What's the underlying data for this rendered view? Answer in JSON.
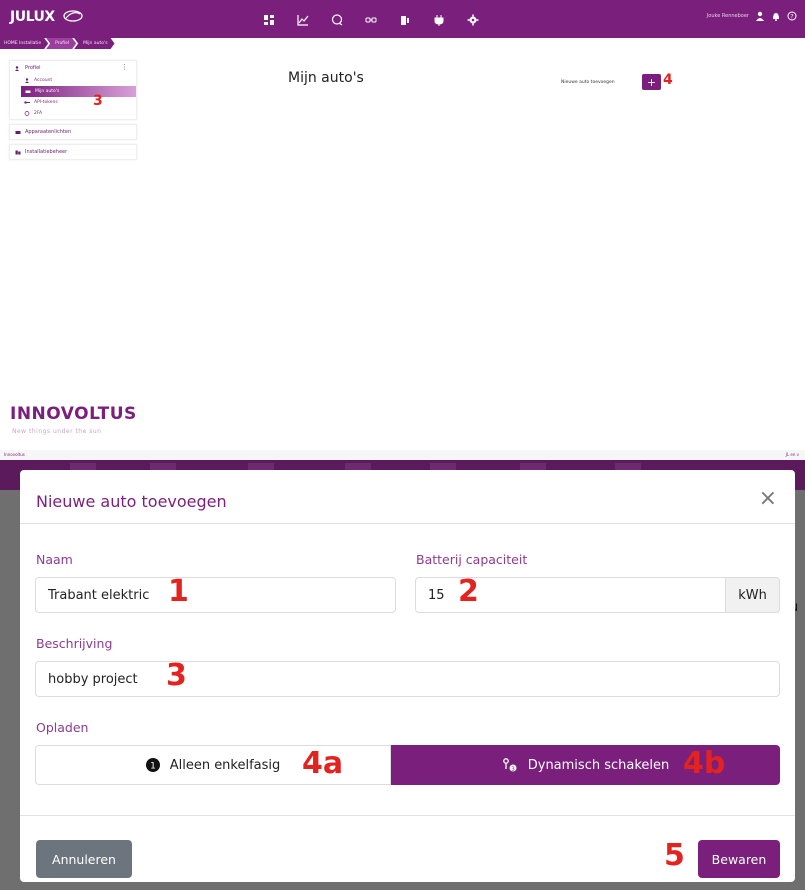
{
  "app": {
    "logo": "JULUX"
  },
  "topbar": {
    "username": "Jouke Renneboer"
  },
  "breadcrumbs": [
    "HOME Installatie",
    "Profiel",
    "Mijn auto's"
  ],
  "sidebar": {
    "groups": [
      {
        "label": "Profiel",
        "items": [
          {
            "label": "Account"
          },
          {
            "label": "Mijn auto's",
            "active": true
          },
          {
            "label": "API-tokens"
          },
          {
            "label": "2FA"
          }
        ]
      },
      {
        "label": "Apparaatenlichten",
        "items": []
      },
      {
        "label": "Installatiebeheer",
        "items": []
      }
    ]
  },
  "main": {
    "title": "Mijn auto's",
    "add_label": "Nieuwe auto toevoegen",
    "add_button": "+"
  },
  "annotations": {
    "a1": "1",
    "a2": "2",
    "a3": "3",
    "a3_sidebar": "3",
    "a4": "4",
    "a4a": "4a",
    "a4b": "4b",
    "a5": "5"
  },
  "brand": {
    "name": "INNOVOLTUS",
    "tagline": "New things under the sun"
  },
  "footer": {
    "left": "Innovoltus",
    "right": "JL en v"
  },
  "modal": {
    "title": "Nieuwe auto toevoegen",
    "close": "×",
    "name_label": "Naam",
    "name_value": "Trabant elektric",
    "battery_label": "Batterij capaciteit",
    "battery_value": "15",
    "battery_unit": "kWh",
    "description_label": "Beschrijving",
    "description_value": "hobby project",
    "charging_label": "Opladen",
    "option_single": "Alleen enkelfasig",
    "option_dynamic": "Dynamisch schakelen",
    "cancel": "Annuleren",
    "save": "Bewaren"
  },
  "colors": {
    "brand": "#7b1f7d",
    "annotation": "#e3231f",
    "cancel": "#6c757d"
  }
}
